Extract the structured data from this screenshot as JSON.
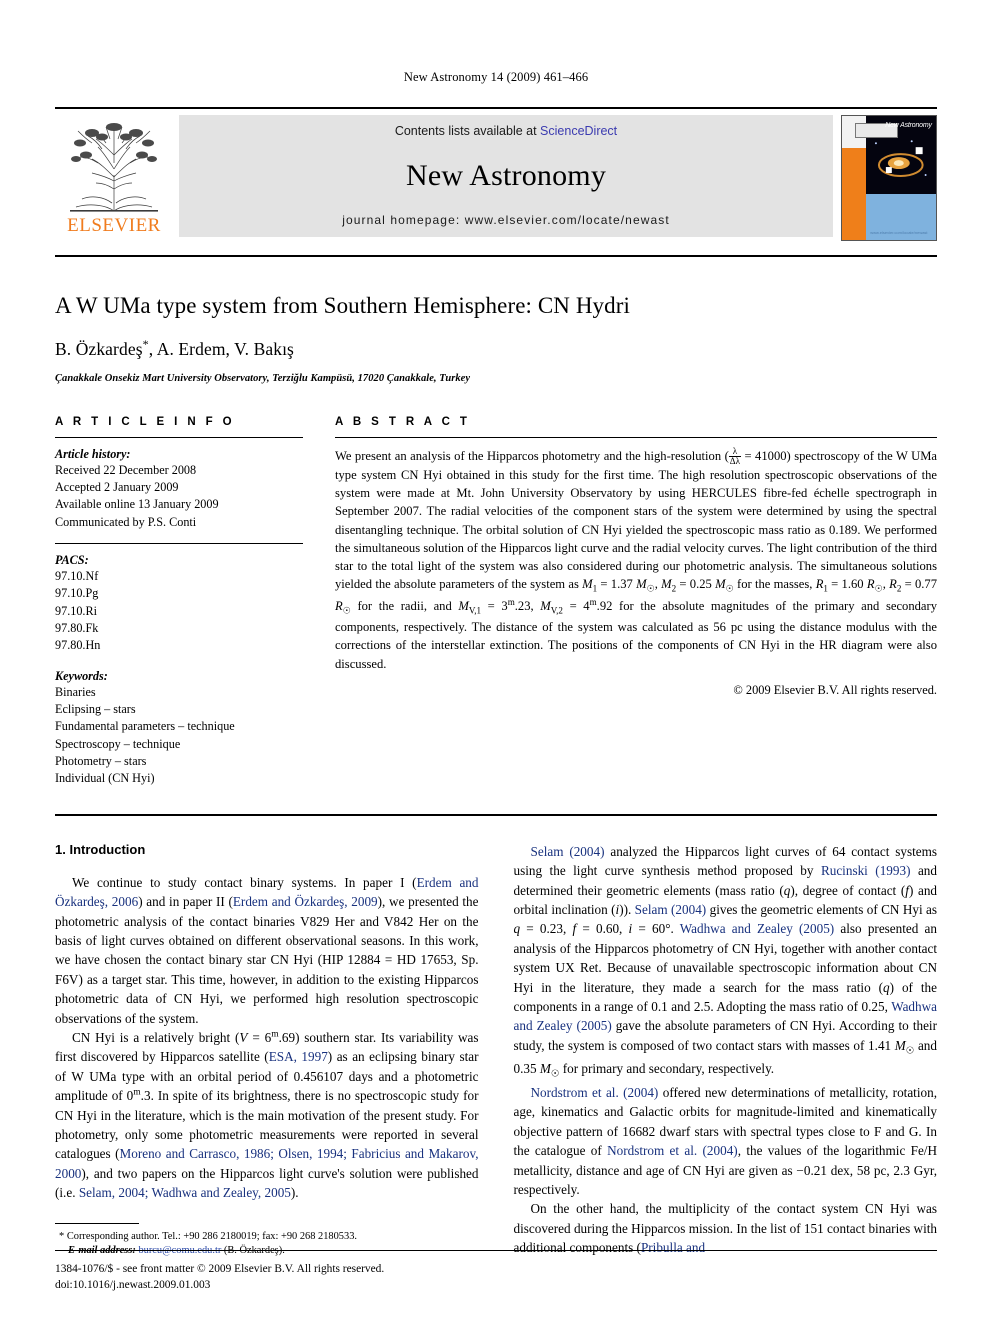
{
  "running_head": "New Astronomy 14 (2009) 461–466",
  "masthead": {
    "publisher_name": "ELSEVIER",
    "contents_prefix": "Contents lists available at ",
    "sciencedirect": "ScienceDirect",
    "journal_name": "New Astronomy",
    "homepage": "journal homepage: www.elsevier.com/locate/newast",
    "cover": {
      "title": "New Astronomy",
      "url": "www.elsevier.com/locate/newast"
    }
  },
  "article": {
    "title": "A W UMa type system from Southern Hemisphere: CN Hydri",
    "authors": "B. Özkardeş",
    "authors_rest": ", A. Erdem, V. Bakış",
    "corresponding_marker": "*",
    "affiliation": "Çanakkale Onsekiz Mart University Observatory, Terziğlu Kampüsü, 17020 Çanakkale, Turkey"
  },
  "article_info": {
    "heading": "A R T I C L E   I N F O",
    "history_label": "Article history:",
    "history": [
      "Received 22 December 2008",
      "Accepted 2 January 2009",
      "Available online 13 January 2009",
      "Communicated by P.S. Conti"
    ],
    "pacs_label": "PACS:",
    "pacs": [
      "97.10.Nf",
      "97.10.Pg",
      "97.10.Ri",
      "97.80.Fk",
      "97.80.Hn"
    ],
    "keywords_label": "Keywords:",
    "keywords": [
      "Binaries",
      "Eclipsing – stars",
      "Fundamental parameters – technique",
      "Spectroscopy – technique",
      "Photometry – stars",
      "Individual (CN Hyi)"
    ]
  },
  "abstract": {
    "heading": "A B S T R A C T",
    "p1_a": "We present an analysis of the Hipparcos photometry and the high-resolution (",
    "p1_frac_num": "λ",
    "p1_frac_den": "Δλ",
    "p1_b": " = 41000) spectroscopy of the W UMa type system CN Hyi obtained in this study for the first time. The high resolution spectroscopic observations of the system were made at Mt. John University Observatory by using HERCULES fibre-fed échelle spectrograph in September 2007. The radial velocities of the component stars of the system were determined by using the spectral disentangling technique. The orbital solution of CN Hyi yielded the spectroscopic mass ratio as 0.189. We performed the simultaneous solution of the Hipparcos light curve and the radial velocity curves. The light contribution of the third star to the total light of the system was also considered during our photometric analysis. The simultaneous solutions yielded the absolute parameters of the system as ",
    "m1": "M",
    "m1_sub": "1",
    "m1_val": " = 1.37 ",
    "msun": "M",
    "msun_sub": "☉",
    "m2_sub": "2",
    "m2_val": " = 0.25 ",
    "masses_tail": " for the masses, ",
    "r1": "R",
    "r1_val": " = 1.60 ",
    "rsun": "R",
    "r2_val": " = 0.77 ",
    "radii_tail": " for the radii, and ",
    "mv1": "M",
    "mv1_sub": "V,1",
    "mv1_val": " = 3",
    "mag_sup": "m",
    "mv1_dec": ".23, ",
    "mv2_sub": "V,2",
    "mv2_val": " = 4",
    "mv2_dec": ".92 for the absolute magnitudes of the primary and secondary components, respectively. The distance of the system was calculated as 56 pc using the distance modulus with the corrections of the interstellar extinction. The positions of the components of CN Hyi in the HR diagram were also discussed.",
    "copyright": "© 2009 Elsevier B.V. All rights reserved."
  },
  "intro": {
    "section_number_title": "1. Introduction",
    "left": {
      "p1_a": "We continue to study contact binary systems. In paper I (",
      "ref1": "Erdem and Özkardeş, 2006",
      "p1_b": ") and in paper II (",
      "ref2": "Erdem and Özkardeş, 2009",
      "p1_c": "), we presented the photometric analysis of the contact binaries V829 Her and V842 Her on the basis of light curves obtained on different observational seasons. In this work, we have chosen the contact binary star CN Hyi (HIP 12884 = HD 17653, Sp. F6V) as a target star. This time, however, in addition to the existing Hipparcos photometric data of CN Hyi, we performed high resolution spectroscopic observations of the system.",
      "p2_a": "CN Hyi is a relatively bright (",
      "p2_v": "V",
      "p2_eq": " = 6",
      "p2_sup": "m",
      "p2_dec": ".69) southern star. Its variability was first discovered by Hipparcos satellite (",
      "ref3": "ESA, 1997",
      "p2_b": ") as an eclipsing binary star of W UMa type with an orbital period of 0.456107 days and a photometric amplitude of 0",
      "p2_sup2": "m",
      "p2_c": ".3. In spite of its brightness, there is no spectroscopic study for CN Hyi in the literature, which is the main motivation of the present study. For photometry, only some photometric measurements were reported in several catalogues (",
      "ref4": "Moreno and Carrasco, 1986; Olsen, 1994; Fabricius and Makarov, 2000",
      "p2_d": "), and two papers on the Hipparcos light curve's solution were published (i.e. ",
      "ref5": "Selam, 2004; Wadhwa and Zealey, 2005",
      "p2_e": ")."
    },
    "right": {
      "p1_ref1": "Selam (2004)",
      "p1_a": " analyzed the Hipparcos light curves of 64 contact systems using the light curve synthesis method proposed by ",
      "p1_ref2": "Rucinski (1993)",
      "p1_b": " and determined their geometric elements (mass ratio (",
      "q": "q",
      "p1_c": "), degree of contact (",
      "f": "f",
      "p1_d": ") and orbital inclination (",
      "i": "i",
      "p1_e": ")). ",
      "p1_ref3": "Selam (2004)",
      "p1_f": " gives the geometric elements of CN Hyi as ",
      "p1_q_val": " = 0.23, ",
      "p1_f_val": " = 0.60, ",
      "p1_i_val": " = 60°. ",
      "p1_ref4": "Wadhwa and Zealey (2005)",
      "p1_g": " also presented an analysis of the Hipparcos photometry of CN Hyi, together with another contact system UX Ret. Because of unavailable spectroscopic information about CN Hyi in the literature, they made a search for the mass ratio (",
      "p1_h": ") of the components in a range of 0.1 and 2.5. Adopting the mass ratio of 0.25, ",
      "p1_ref5": "Wadhwa and Zealey (2005)",
      "p1_i": " gave the absolute parameters of CN Hyi. According to their study, the system is composed of two contact stars with masses of 1.41 ",
      "msun": "M",
      "msun_sub": "☉",
      "p1_j": " and 0.35 ",
      "p1_k": " for primary and secondary, respectively.",
      "p2_ref1": "Nordstrom et al. (2004)",
      "p2_a": " offered new determinations of metallicity, rotation, age, kinematics and Galactic orbits for magnitude-limited and kinematically objective pattern of 16682 dwarf stars with spectral types close to F and G. In the catalogue of ",
      "p2_ref2": "Nordstrom et al. (2004)",
      "p2_b": ", the values of the logarithmic Fe/H metallicity, distance and age of CN Hyi are given as −0.21 dex, 58 pc, 2.3 Gyr, respectively.",
      "p3_a": "On the other hand, the multiplicity of the contact system CN Hyi was discovered during the Hipparcos mission. In the list of 151 contact binaries with additional components (",
      "p3_ref": "Pribulla and"
    }
  },
  "footnote": {
    "marker": "*",
    "line1": "Corresponding author. Tel.: +90 286 2180019; fax: +90 268 2180533.",
    "email_label": "E-mail address:",
    "email": "burcu@comu.edu.tr",
    "email_tail": " (B. Özkardeş)."
  },
  "page_footer": {
    "line1": "1384-1076/$ - see front matter © 2009 Elsevier B.V. All rights reserved.",
    "line2": "doi:10.1016/j.newast.2009.01.003"
  },
  "colors": {
    "link": "#18317e",
    "sciencedirect": "#3b3bb0",
    "elsevier_orange": "#f07c1e",
    "masthead_bg": "#e3e3e3"
  }
}
